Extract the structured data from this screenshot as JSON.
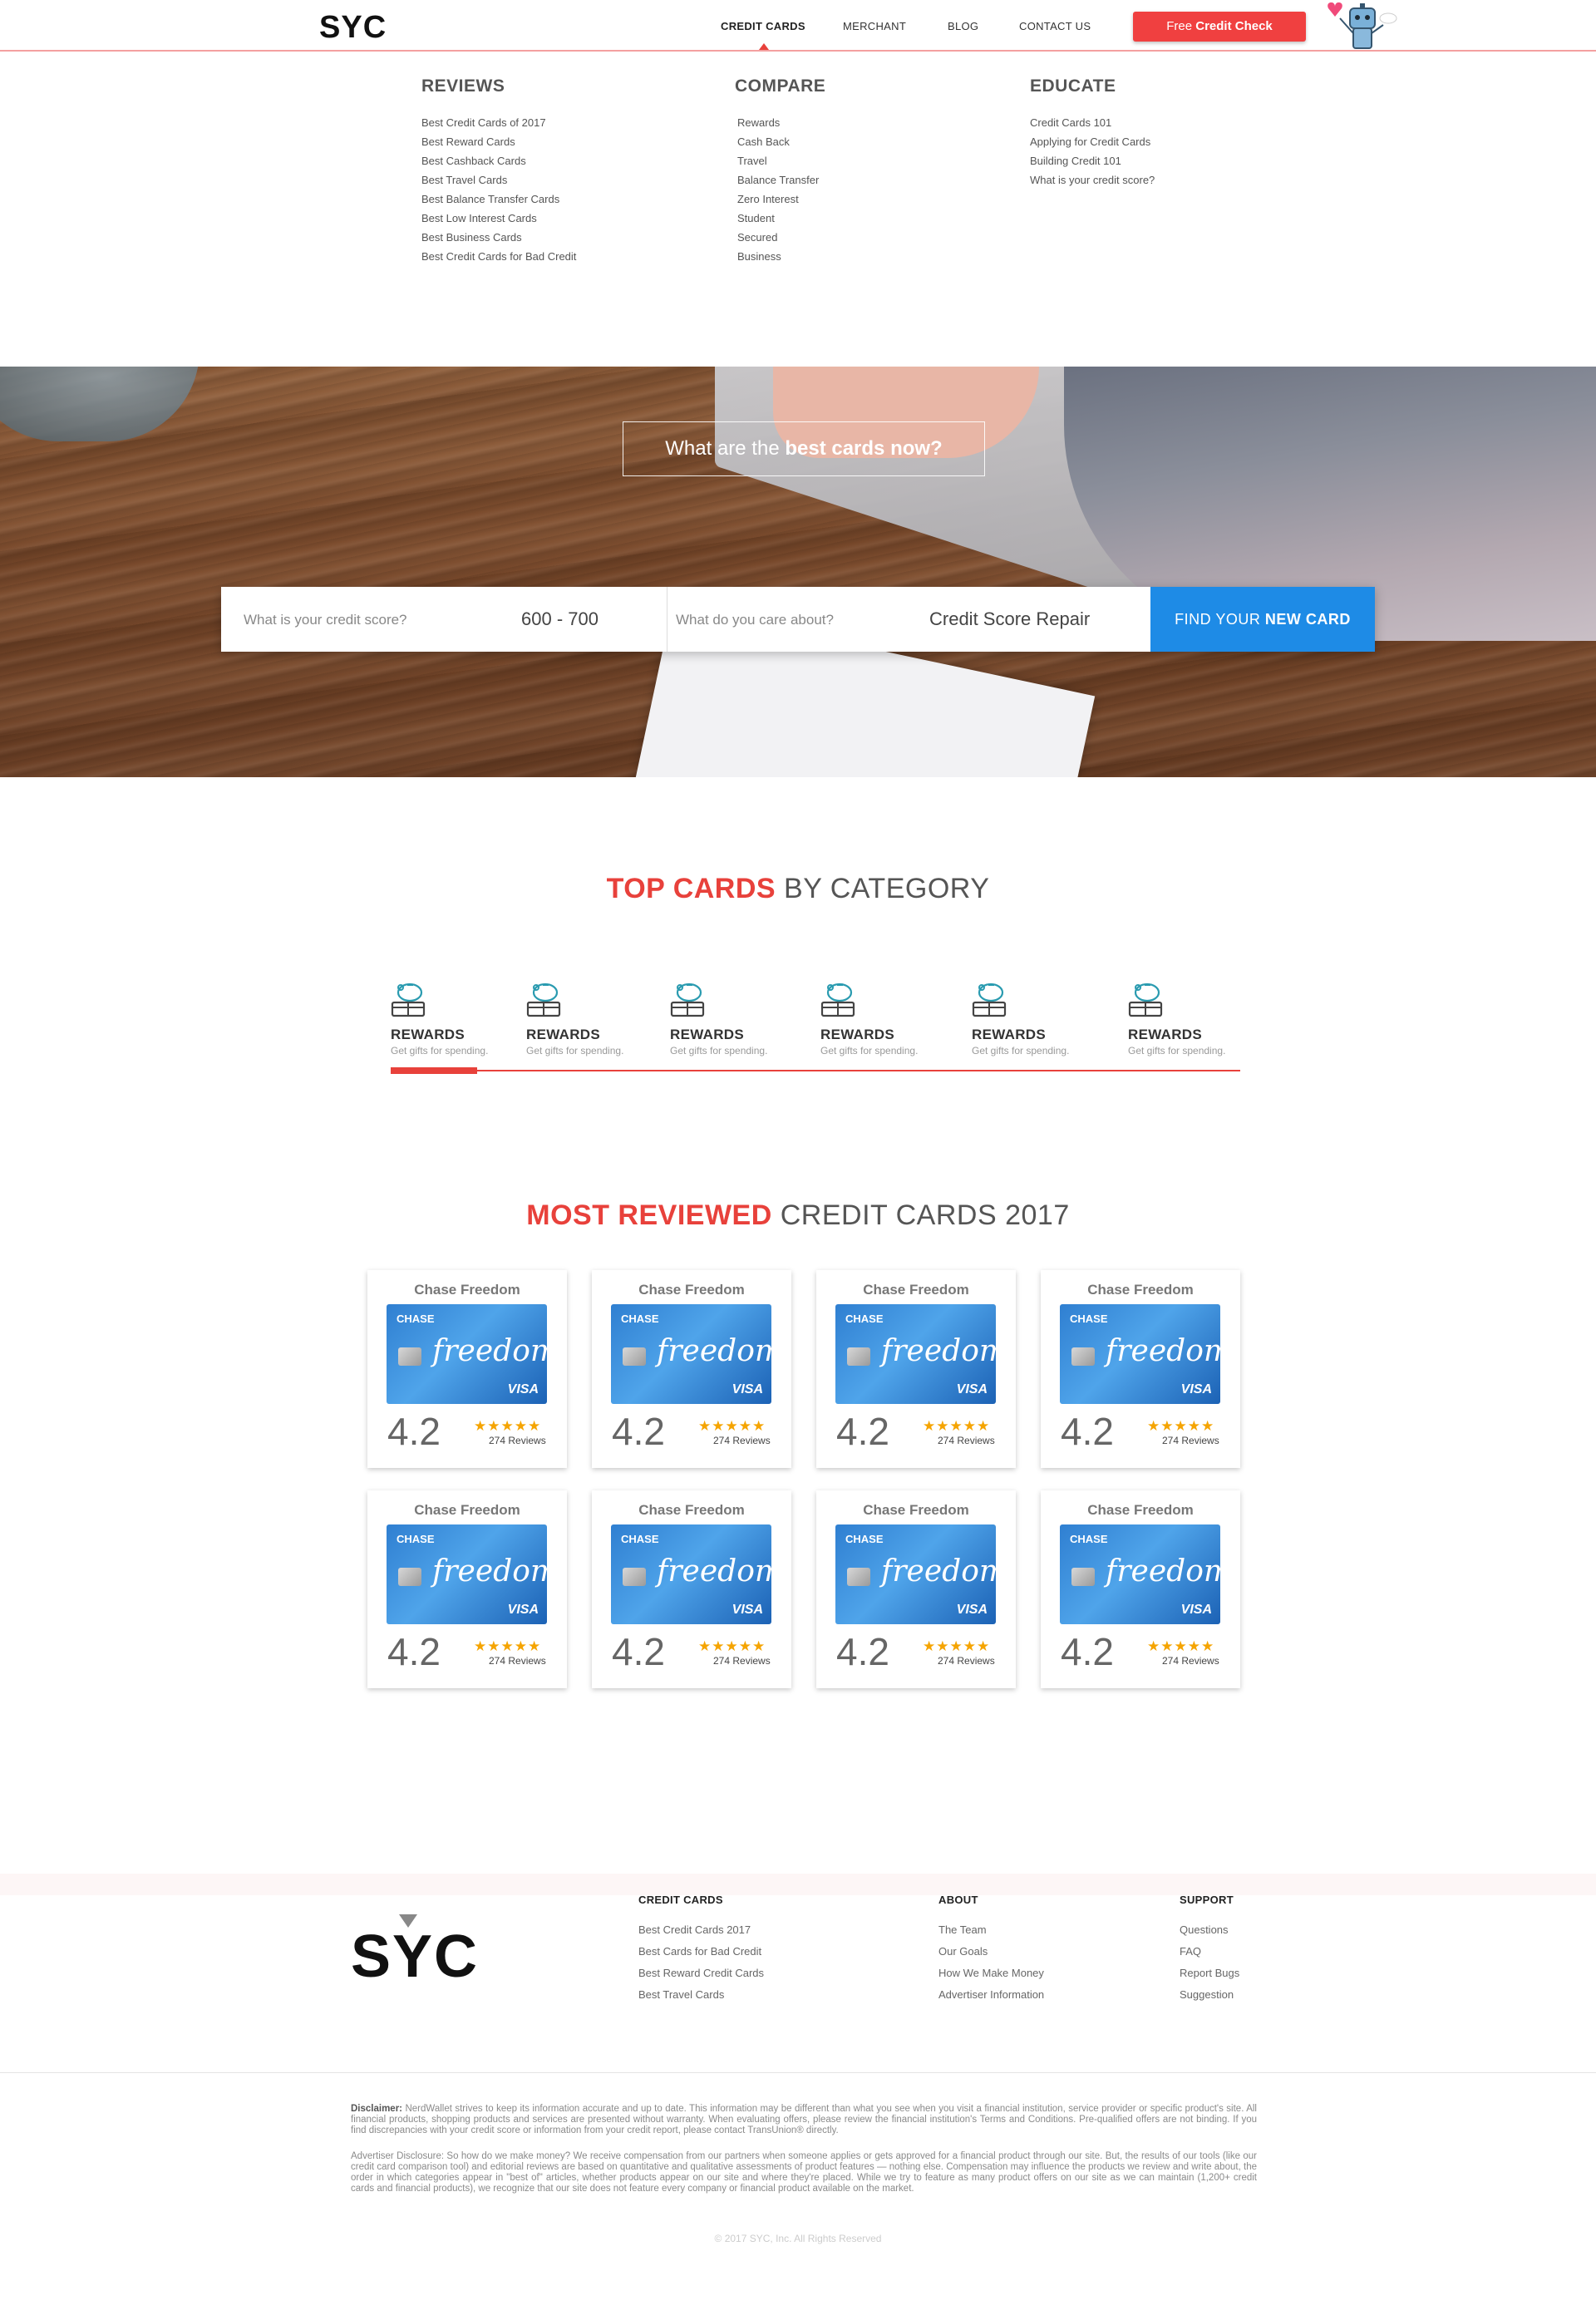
{
  "header": {
    "logo": "SYC",
    "nav": [
      "CREDIT CARDS",
      "MERCHANT",
      "BLOG",
      "CONTACT US"
    ],
    "cta_prefix": "Free ",
    "cta_bold": "Credit Check"
  },
  "menu": {
    "reviews": {
      "title": "REVIEWS",
      "items": [
        "Best Credit Cards of 2017",
        "Best Reward Cards",
        "Best Cashback Cards",
        "Best Travel Cards",
        "Best Balance Transfer Cards",
        "Best Low Interest Cards",
        "Best Business Cards",
        "Best Credit Cards for Bad Credit"
      ]
    },
    "compare": {
      "title": "COMPARE",
      "items": [
        "Rewards",
        "Cash Back",
        "Travel",
        "Balance Transfer",
        "Zero Interest",
        "Student",
        "Secured",
        "Business"
      ]
    },
    "educate": {
      "title": "EDUCATE",
      "items": [
        "Credit Cards 101",
        "Applying for Credit Cards",
        "Building Credit 101",
        "What is your credit score?"
      ]
    }
  },
  "hero": {
    "question_prefix": "What are the ",
    "question_bold": "best cards now?",
    "score_label": "What is your credit score?",
    "score_value": "600 - 700",
    "care_label": "What do you care about?",
    "care_value": "Credit Score Repair",
    "button_prefix": "FIND YOUR ",
    "button_bold": "NEW CARD"
  },
  "top_cards": {
    "title_accent": "TOP CARDS",
    "title_rest": " BY CATEGORY",
    "categories": [
      {
        "name": "REWARDS",
        "desc": "Get gifts for spending."
      },
      {
        "name": "REWARDS",
        "desc": "Get gifts for spending."
      },
      {
        "name": "REWARDS",
        "desc": "Get gifts for spending."
      },
      {
        "name": "REWARDS",
        "desc": "Get gifts for spending."
      },
      {
        "name": "REWARDS",
        "desc": "Get gifts for spending."
      },
      {
        "name": "REWARDS",
        "desc": "Get gifts for spending."
      }
    ]
  },
  "most_reviewed": {
    "title_accent": "MOST REVIEWED",
    "title_rest": " CREDIT CARDS 2017",
    "cards": [
      {
        "name": "Chase Freedom",
        "brand": "CHASE",
        "logo": "freedom",
        "network": "VISA",
        "rating": "4.2",
        "stars": "★★★★★",
        "reviews": "274 Reviews"
      },
      {
        "name": "Chase Freedom",
        "brand": "CHASE",
        "logo": "freedom",
        "network": "VISA",
        "rating": "4.2",
        "stars": "★★★★★",
        "reviews": "274 Reviews"
      },
      {
        "name": "Chase Freedom",
        "brand": "CHASE",
        "logo": "freedom",
        "network": "VISA",
        "rating": "4.2",
        "stars": "★★★★★",
        "reviews": "274 Reviews"
      },
      {
        "name": "Chase Freedom",
        "brand": "CHASE",
        "logo": "freedom",
        "network": "VISA",
        "rating": "4.2",
        "stars": "★★★★★",
        "reviews": "274 Reviews"
      },
      {
        "name": "Chase Freedom",
        "brand": "CHASE",
        "logo": "freedom",
        "network": "VISA",
        "rating": "4.2",
        "stars": "★★★★★",
        "reviews": "274 Reviews"
      },
      {
        "name": "Chase Freedom",
        "brand": "CHASE",
        "logo": "freedom",
        "network": "VISA",
        "rating": "4.2",
        "stars": "★★★★★",
        "reviews": "274 Reviews"
      },
      {
        "name": "Chase Freedom",
        "brand": "CHASE",
        "logo": "freedom",
        "network": "VISA",
        "rating": "4.2",
        "stars": "★★★★★",
        "reviews": "274 Reviews"
      },
      {
        "name": "Chase Freedom",
        "brand": "CHASE",
        "logo": "freedom",
        "network": "VISA",
        "rating": "4.2",
        "stars": "★★★★★",
        "reviews": "274 Reviews"
      }
    ]
  },
  "footer": {
    "logo": "SYC",
    "credit_cards": {
      "title": "CREDIT CARDS",
      "items": [
        "Best Credit Cards 2017",
        "Best Cards for Bad Credit",
        "Best Reward Credit Cards",
        "Best Travel Cards"
      ]
    },
    "about": {
      "title": "ABOUT",
      "items": [
        "The Team",
        "Our Goals",
        "How We Make Money",
        "Advertiser Information"
      ]
    },
    "support": {
      "title": "SUPPORT",
      "items": [
        "Questions",
        "FAQ",
        "Report Bugs",
        "Suggestion"
      ]
    },
    "disclaimer_label": "Disclaimer:",
    "disclaimer_text": " NerdWallet strives to keep its information accurate and up to date. This information may be different than what you see when you visit a financial institution, service provider or specific product's site. All financial products, shopping products and services are presented without warranty. When evaluating offers, please review the financial institution's Terms and Conditions. Pre-qualified offers are not binding. If you find discrepancies with your credit score or information from your credit report, please contact TransUnion® directly.",
    "advertiser_text": "Advertiser Disclosure: So how do we make money? We receive compensation from our partners when someone applies or gets approved for a financial product through our site. But, the results of our tools (like our credit card comparison tool) and editorial reviews are based on quantitative and qualitative assessments of product features — nothing else. Compensation may influence the products we review and write about, the order in which categories appear in \"best of\" articles, whether products appear on our site and where they're placed. While we try to feature as many product offers on our site as we can maintain (1,200+ credit cards and financial products), we recognize that our site does not feature every company or financial product available on the market.",
    "copyright": "© 2017 SYC, Inc. All Rights Reserved"
  },
  "colors": {
    "accent": "#e8413b",
    "button_blue": "#1e8be6",
    "star": "#f5a400"
  }
}
